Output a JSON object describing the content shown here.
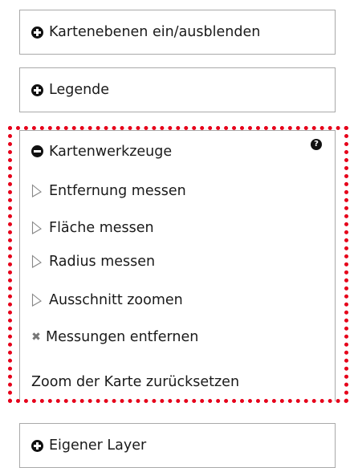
{
  "panels": {
    "layers_label": "Kartenebenen ein/ausblenden",
    "legend_label": "Legende",
    "own_layer_label": "Eigener Layer"
  },
  "tools": {
    "header_label": "Kartenwerkzeuge",
    "help_glyph": "?",
    "items": [
      {
        "label": "Entfernung messen",
        "icon": "pointer-arrow-icon"
      },
      {
        "label": "Fläche messen",
        "icon": "pointer-arrow-icon"
      },
      {
        "label": "Radius messen",
        "icon": "pointer-arrow-icon"
      },
      {
        "label": "Ausschnitt zoomen",
        "icon": "pointer-arrow-icon"
      },
      {
        "label": "Messungen entfernen",
        "icon": "close-icon"
      },
      {
        "label": "Zoom der Karte zurücksetzen",
        "icon": ""
      }
    ]
  },
  "colors": {
    "highlight_border": "#e6001a",
    "panel_border": "#a9a9a9",
    "icon": "#111111"
  }
}
